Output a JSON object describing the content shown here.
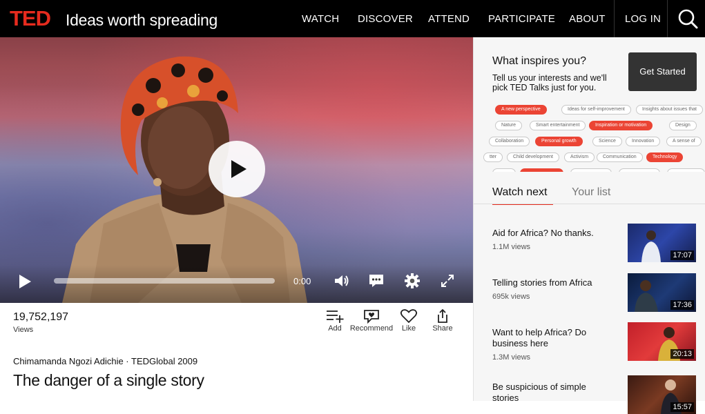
{
  "header": {
    "logo": "TED",
    "tagline": "Ideas worth spreading",
    "nav": [
      "WATCH",
      "DISCOVER",
      "ATTEND",
      "PARTICIPATE",
      "ABOUT"
    ],
    "login": "LOG IN",
    "search_icon": "search-icon"
  },
  "player": {
    "time": "0:00",
    "progress_fraction": 0,
    "icons": [
      "play-icon",
      "volume-icon",
      "transcript-icon",
      "settings-icon",
      "fullscreen-icon"
    ]
  },
  "stats": {
    "views_count": "19,752,197",
    "views_label": "Views",
    "actions": [
      {
        "label": "Add",
        "icon": "add-to-list-icon"
      },
      {
        "label": "Recommend",
        "icon": "recommend-icon"
      },
      {
        "label": "Like",
        "icon": "heart-icon"
      },
      {
        "label": "Share",
        "icon": "share-icon"
      }
    ]
  },
  "talk": {
    "speaker_event": "Chimamanda Ngozi Adichie · TEDGlobal 2009",
    "title": "The danger of a single story"
  },
  "sidebar": {
    "inspire_title": "What inspires you?",
    "inspire_desc": "Tell us your interests and we'll pick TED Talks just for you.",
    "get_started": "Get Started",
    "tags": [
      {
        "label": "A new perspective",
        "on": true
      },
      {
        "label": "Ideas for self-improvement",
        "on": false
      },
      {
        "label": "Insights about issues that",
        "on": false
      },
      {
        "label": "Nature",
        "on": false
      },
      {
        "label": "Smart entertainment",
        "on": false
      },
      {
        "label": "Inspiration or motivation",
        "on": true
      },
      {
        "label": "Design",
        "on": false
      },
      {
        "label": "Collaboration",
        "on": false
      },
      {
        "label": "Personal growth",
        "on": true
      },
      {
        "label": "Science",
        "on": false
      },
      {
        "label": "Innovation",
        "on": false
      },
      {
        "label": "A sense of",
        "on": false
      },
      {
        "label": "tter",
        "on": false
      },
      {
        "label": "Child development",
        "on": false
      },
      {
        "label": "Activism",
        "on": false
      },
      {
        "label": "Communication",
        "on": false
      },
      {
        "label": "Technology",
        "on": true
      }
    ],
    "tabs": [
      "Watch next",
      "Your list"
    ],
    "recommendations": [
      {
        "title": "Aid for Africa? No thanks.",
        "views": "1.1M views",
        "duration": "17:07"
      },
      {
        "title": "Telling stories from Africa",
        "views": "695k views",
        "duration": "17:36"
      },
      {
        "title": "Want to help Africa? Do business here",
        "views": "1.3M views",
        "duration": "20:13"
      },
      {
        "title": "Be suspicious of simple stories",
        "views": "",
        "duration": "15:57"
      }
    ],
    "accent": "#e62b1e"
  }
}
